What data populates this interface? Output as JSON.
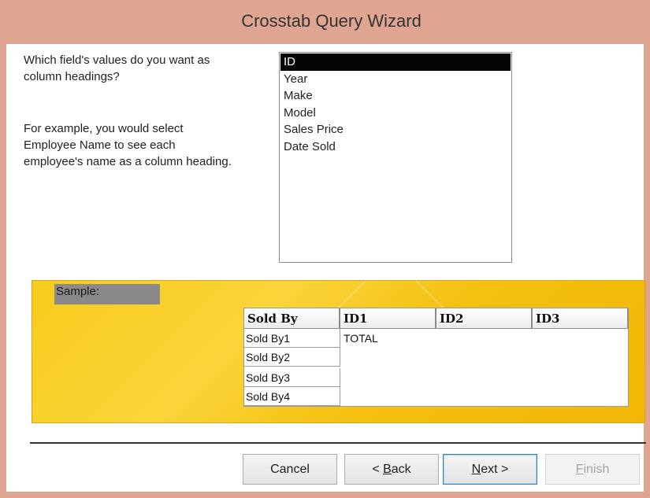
{
  "window": {
    "title": "Crosstab Query Wizard"
  },
  "prompt": {
    "question_line1": "Which field's values do you want as",
    "question_line2": "column headings?",
    "example_line1": "For example, you would select",
    "example_line2": "Employee Name to see each",
    "example_line3": "employee's name as a column heading."
  },
  "fields": {
    "items": [
      {
        "label": "ID",
        "selected": true
      },
      {
        "label": "Year",
        "selected": false
      },
      {
        "label": "Make",
        "selected": false
      },
      {
        "label": "Model",
        "selected": false
      },
      {
        "label": "Sales Price",
        "selected": false
      },
      {
        "label": "Date Sold",
        "selected": false
      }
    ]
  },
  "sample": {
    "label": "Sample:",
    "row_header": "Sold By",
    "column_headers": [
      "ID1",
      "ID2",
      "ID3"
    ],
    "rows": [
      "Sold By1",
      "Sold By2",
      "Sold By3",
      "Sold By4"
    ],
    "total_label": "TOTAL"
  },
  "buttons": {
    "cancel": "Cancel",
    "back": "< Back",
    "next": "Next >",
    "finish": "Finish",
    "finish_enabled": false
  },
  "colors": {
    "title_bar": "#e0a591",
    "sample_background": "#f8cb1b",
    "selection": "#050505"
  }
}
